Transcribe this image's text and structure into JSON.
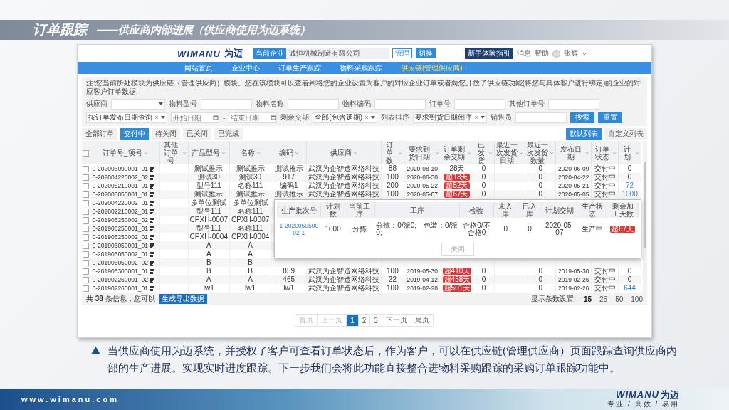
{
  "slide": {
    "title": "订单跟踪",
    "subtitle": "——供应商内部进展（供应商使用为迈系统）",
    "caption": "当供应商使用为迈系统，并授权了客户可查看订单状态后，作为客户，可以在供应链(管理供应商）页面跟踪查询供应商内部的生产进展。实现实时进度跟踪。下一步我们会将此功能直接整合进物料采购跟踪的采购订单跟踪功能中。",
    "footer_url": "www.wimanu.com",
    "footer_logo": {
      "latin": "WIMANU",
      "cjk": "为迈",
      "slogan": "专业 / 高效 / 易用"
    }
  },
  "app": {
    "header": {
      "logo": {
        "latin": "WIMANU",
        "cjk": "为迈"
      },
      "company_badge": "当前企业",
      "company": "诚恒机械制造有限公司",
      "buttons": [
        "管理",
        "切换"
      ],
      "guide_button": "新手体验指引",
      "links": [
        "消息",
        "帮助"
      ],
      "user": "张辉"
    },
    "nav": [
      {
        "label": "网站首页",
        "selected": false
      },
      {
        "label": "企业中心",
        "selected": false
      },
      {
        "label": "订单生产跟踪",
        "selected": false
      },
      {
        "label": "物料采购跟踪",
        "selected": false
      },
      {
        "label": "供应链(管理供应商)",
        "selected": true
      }
    ],
    "notice": "注:您当前所处模块为供应链（管理供应商）模块。您在该模块可以查看到将您的企业设置为客户的对应企业订单或者向您开放了供应链功能(将您与具体客户进行绑定)的企业的对应客户订单数据;",
    "filters_row1": [
      {
        "label": "供应商",
        "kind": "select"
      },
      {
        "label": "物料型号",
        "kind": "text"
      },
      {
        "label": "物料名称",
        "kind": "text"
      },
      {
        "label": "物料编码",
        "kind": "text"
      },
      {
        "label": "订单号",
        "kind": "text"
      },
      {
        "label": "其他订单号",
        "kind": "text"
      }
    ],
    "filters_row2": [
      {
        "kind": "select",
        "value": "按订单发布日期查询",
        "clearable": true
      },
      {
        "kind": "date",
        "placeholder": "开始日期"
      },
      {
        "kind": "separator",
        "text": "-"
      },
      {
        "kind": "date",
        "placeholder": "结束日期"
      },
      {
        "kind": "select",
        "label": "剩余交期",
        "value": "全部(包含延期)",
        "clearable": true
      },
      {
        "kind": "select",
        "label": "列表排序",
        "value": "要求到货日期倒序",
        "clearable": true
      },
      {
        "kind": "text",
        "label": "销售员"
      }
    ],
    "filter_buttons": [
      "搜索",
      "重置"
    ],
    "tabs": [
      {
        "label": "全部订单",
        "selected": false
      },
      {
        "label": "交付中",
        "selected": true
      },
      {
        "label": "待关闭",
        "selected": false
      },
      {
        "label": "已关闭",
        "selected": false
      },
      {
        "label": "已完成",
        "selected": false
      }
    ],
    "list_buttons": [
      {
        "label": "默认列表",
        "selected": true
      },
      {
        "label": "自定义列表",
        "selected": false
      }
    ],
    "table": {
      "select_all_checked": false,
      "columns": [
        "订单号_项号",
        "其他订单号",
        "产品型号",
        "名称",
        "编码",
        "供应商",
        "订单数",
        "要求到货日期",
        "订单剩余交期",
        "已发货",
        "最近一次发货日期",
        "最近一次发货数量",
        "发布日期",
        "订单状态",
        "计划"
      ],
      "rows": [
        {
          "checked": false,
          "order_no": "0-202006090001_01",
          "model": "测试推示",
          "name": "测试推示",
          "code": "测试推示",
          "supplier": "武汉为企智造网络科技",
          "qty": "88",
          "due_date": "2020-08-10",
          "remaining": "28天",
          "overdue": false,
          "shipped": "0",
          "last_ship_qty": "0",
          "publish_date": "2020-06-09",
          "status": "交付中",
          "plan": "0",
          "plan_link": false
        },
        {
          "checked": false,
          "order_no": "0-202004220002_02",
          "model": "测试30",
          "name": "测试30",
          "code": "917",
          "supplier": "武汉为企智造网络科技",
          "qty": "100",
          "due_date": "2020-06-30",
          "remaining": "超13天",
          "overdue": true,
          "shipped": "0",
          "last_ship_qty": "0",
          "publish_date": "2020-04-22",
          "status": "交付中",
          "plan": "0",
          "plan_link": false
        },
        {
          "checked": false,
          "order_no": "0-202005210001_01",
          "model": "型号111",
          "name": "名称111",
          "code": "编码1",
          "supplier": "武汉为企智造网络科技",
          "qty": "200",
          "due_date": "2020-05-22",
          "remaining": "超52天",
          "overdue": true,
          "shipped": "0",
          "last_ship_qty": "0",
          "publish_date": "2020-05-21",
          "status": "交付中",
          "plan": "72",
          "plan_link": true
        },
        {
          "checked": false,
          "order_no": "0-202005050001_01",
          "model": "测试推示",
          "name": "测试推示",
          "code": "测试推示",
          "supplier": "武汉为企智造网络科技",
          "qty": "100",
          "due_date": "2020-05-07",
          "remaining": "超67天",
          "overdue": true,
          "shipped": "0",
          "last_ship_qty": "0",
          "publish_date": "2020-05-05",
          "status": "交付中",
          "plan": "1000",
          "plan_link": true
        },
        {
          "checked": false,
          "order_no": "0-202004220002_01",
          "model": "多单位测试",
          "name": "多单位测试"
        },
        {
          "checked": false,
          "order_no": "0-202002210002_01",
          "model": "型号111",
          "name": "名称111"
        },
        {
          "checked": false,
          "order_no": "0-201906250002_02",
          "model": "CPXH-0007",
          "name": "CPXH-0007"
        },
        {
          "checked": false,
          "order_no": "0-201906250001_01",
          "model": "型号111",
          "name": "名称111"
        },
        {
          "checked": false,
          "order_no": "0-201906250002_01",
          "model": "CPXH-0004",
          "name": "CPXH-0004"
        },
        {
          "checked": false,
          "order_no": "0-201906050001_01",
          "model": "A",
          "name": "A"
        },
        {
          "checked": false,
          "order_no": "0-201906050002_01",
          "model": "A",
          "name": "A"
        },
        {
          "checked": false,
          "order_no": "0-201906050002_02",
          "model": "B",
          "name": "B"
        },
        {
          "checked": false,
          "order_no": "0-201905300001_01",
          "model": "B",
          "name": "B",
          "code": "859",
          "supplier": "武汉为企智造网络科技",
          "qty": "100",
          "due_date": "2019-05-30",
          "remaining": "超410天",
          "overdue": true,
          "shipped": "0",
          "last_ship_qty": "0",
          "publish_date": "2019-05-30",
          "status": "交付中",
          "plan": "0",
          "plan_link": false
        },
        {
          "checked": false,
          "order_no": "0-201902260001_02",
          "model": "A",
          "name": "A",
          "code": "465",
          "supplier": "武汉为企智造网络科技",
          "qty": "22",
          "due_date": "2019-04-12",
          "remaining": "超458天",
          "overdue": true,
          "shipped": "0",
          "last_ship_qty": "0",
          "publish_date": "2019-02-26",
          "status": "交付中",
          "plan": "0",
          "plan_link": false
        },
        {
          "checked": false,
          "order_no": "0-201902260001_01",
          "model": "lw1",
          "name": "lw1",
          "code": "lw1",
          "supplier": "武汉为企智造网络科技",
          "qty": "100",
          "due_date": "2019-02-28",
          "remaining": "超501天",
          "overdue": true,
          "shipped": "0",
          "last_ship_qty": "0",
          "publish_date": "2019-02-26",
          "status": "交付中",
          "plan": "644",
          "plan_link": true
        }
      ],
      "summary": "共 **38** 条信息，您可以",
      "export_button": "生成导出数据",
      "page_size_label": "显示条数设置:",
      "page_sizes": [
        {
          "label": "15",
          "selected": true
        },
        {
          "label": "25",
          "selected": false
        },
        {
          "label": "50",
          "selected": false
        },
        {
          "label": "100",
          "selected": false
        }
      ]
    },
    "popup": {
      "columns": [
        "生产批次号",
        "计划数",
        "当前工序",
        "工序",
        "检验",
        "未入库",
        "已入库",
        "计划交期",
        "生产状态",
        "剩余加工天数"
      ],
      "row": {
        "batch": "1-202005050002-1",
        "cells": [
          "1000",
          "分拣",
          "分拣：0/派0;　包装：0/派0;",
          "合格0/不合格0",
          "0",
          "0",
          "2020-05-07",
          "生产中"
        ],
        "remaining": "超67天",
        "overdue": true
      },
      "close_button": "关闭"
    },
    "pagination": [
      {
        "label": "首页",
        "selected": false,
        "disabled": true
      },
      {
        "label": "上一页",
        "selected": false,
        "disabled": true
      },
      {
        "label": "1",
        "selected": true,
        "disabled": false
      },
      {
        "label": "2",
        "selected": false,
        "disabled": false
      },
      {
        "label": "3",
        "selected": false,
        "disabled": false
      },
      {
        "label": "下一页",
        "selected": false,
        "disabled": false
      },
      {
        "label": "尾页",
        "selected": false,
        "disabled": false
      }
    ]
  }
}
